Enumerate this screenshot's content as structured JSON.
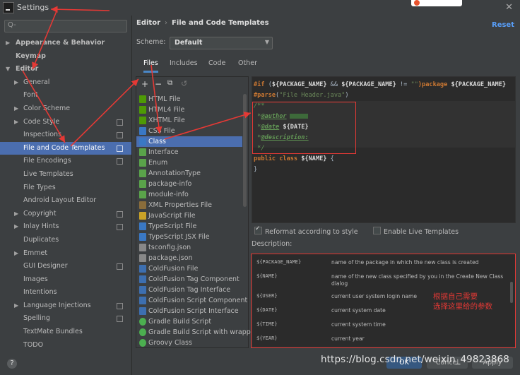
{
  "window": {
    "title": "Settings"
  },
  "search": {
    "placeholder": "Q-"
  },
  "sidebar": {
    "items": [
      {
        "label": "Appearance & Behavior"
      },
      {
        "label": "Keymap"
      },
      {
        "label": "Editor"
      },
      {
        "label": "General"
      },
      {
        "label": "Font"
      },
      {
        "label": "Color Scheme"
      },
      {
        "label": "Code Style"
      },
      {
        "label": "Inspections"
      },
      {
        "label": "File and Code Templates"
      },
      {
        "label": "File Encodings"
      },
      {
        "label": "Live Templates"
      },
      {
        "label": "File Types"
      },
      {
        "label": "Android Layout Editor"
      },
      {
        "label": "Copyright"
      },
      {
        "label": "Inlay Hints"
      },
      {
        "label": "Duplicates"
      },
      {
        "label": "Emmet"
      },
      {
        "label": "GUI Designer"
      },
      {
        "label": "Images"
      },
      {
        "label": "Intentions"
      },
      {
        "label": "Language Injections"
      },
      {
        "label": "Spelling"
      },
      {
        "label": "TextMate Bundles"
      },
      {
        "label": "TODO"
      }
    ]
  },
  "breadcrumb": {
    "root": "Editor",
    "separator": "›",
    "current": "File and Code Templates"
  },
  "reset_label": "Reset",
  "scheme": {
    "label": "Scheme:",
    "value": "Default"
  },
  "tabs": [
    {
      "label": "Files"
    },
    {
      "label": "Includes"
    },
    {
      "label": "Code"
    },
    {
      "label": "Other"
    }
  ],
  "templates": [
    {
      "label": "HTML File",
      "icon": "html-file-icon",
      "color": "#4e9a06"
    },
    {
      "label": "HTML4 File",
      "icon": "html-file-icon",
      "color": "#4e9a06"
    },
    {
      "label": "XHTML File",
      "icon": "html-file-icon",
      "color": "#4e9a06"
    },
    {
      "label": "CSS File",
      "icon": "css-file-icon",
      "color": "#3a78c4"
    },
    {
      "label": "Class",
      "icon": "class-icon",
      "color": "#3a78c4"
    },
    {
      "label": "Interface",
      "icon": "interface-icon",
      "color": "#5aa34a"
    },
    {
      "label": "Enum",
      "icon": "enum-icon",
      "color": "#5aa34a"
    },
    {
      "label": "AnnotationType",
      "icon": "annotation-icon",
      "color": "#5aa34a"
    },
    {
      "label": "package-info",
      "icon": "package-info-icon",
      "color": "#5aa34a"
    },
    {
      "label": "module-info",
      "icon": "module-info-icon",
      "color": "#5aa34a"
    },
    {
      "label": "XML Properties File",
      "icon": "xml-file-icon",
      "color": "#8a6d3b"
    },
    {
      "label": "JavaScript File",
      "icon": "js-file-icon",
      "color": "#c9a227"
    },
    {
      "label": "TypeScript File",
      "icon": "ts-file-icon",
      "color": "#3a78c4"
    },
    {
      "label": "TypeScript JSX File",
      "icon": "tsx-file-icon",
      "color": "#3a78c4"
    },
    {
      "label": "tsconfig.json",
      "icon": "json-file-icon",
      "color": "#888888"
    },
    {
      "label": "package.json",
      "icon": "json-file-icon",
      "color": "#888888"
    },
    {
      "label": "ColdFusion File",
      "icon": "coldfusion-icon",
      "color": "#3d6fb0"
    },
    {
      "label": "ColdFusion Tag Component",
      "icon": "coldfusion-icon",
      "color": "#3d6fb0"
    },
    {
      "label": "ColdFusion Tag Interface",
      "icon": "coldfusion-icon",
      "color": "#3d6fb0"
    },
    {
      "label": "ColdFusion Script Component",
      "icon": "coldfusion-icon",
      "color": "#3d6fb0"
    },
    {
      "label": "ColdFusion Script Interface",
      "icon": "coldfusion-icon",
      "color": "#3d6fb0"
    },
    {
      "label": "Gradle Build Script",
      "icon": "gradle-icon",
      "color": "#4caf50"
    },
    {
      "label": "Gradle Build Script with wrappe",
      "icon": "gradle-icon",
      "color": "#4caf50"
    },
    {
      "label": "Groovy Class",
      "icon": "groovy-icon",
      "color": "#4caf50"
    }
  ],
  "editor": {
    "l1a": "#if",
    "l1b": " (",
    "l1c": "${PACKAGE_NAME}",
    "l1d": " && ",
    "l1e": "${PACKAGE_NAME}",
    "l1f": " != ",
    "l1g": "\"\"",
    "l1h": ")package ",
    "l1i": "${PACKAGE_NAME}",
    "l2a": "#parse",
    "l2b": "(",
    "l2c": "\"File Header.java\"",
    "l2d": ")",
    "l3": "/**",
    "l4a": " *",
    "l4b": "@author",
    "l5a": " *",
    "l5b": "@date",
    "l5c": " ${DATE}",
    "l6a": " *",
    "l6b": "@description:",
    "l7": " */",
    "l8a": "public class ",
    "l8b": "${NAME}",
    "l8c": " {",
    "l9": "}"
  },
  "options": {
    "reformat": "Reformat according to style",
    "live_templates": "Enable Live Templates"
  },
  "description": {
    "label": "Description:",
    "rows": [
      {
        "name": "${PACKAGE_NAME}",
        "text": "name of the package in which the new class is created"
      },
      {
        "name": "${NAME}",
        "text": "name of the new class specified by you in the Create New Class dialog"
      },
      {
        "name": "${USER}",
        "text": "current user system login name"
      },
      {
        "name": "${DATE}",
        "text": "current system date"
      },
      {
        "name": "${TIME}",
        "text": "current system time"
      },
      {
        "name": "${YEAR}",
        "text": "current year"
      }
    ]
  },
  "annotation": {
    "line1": "根据自己需要",
    "line2": "选择这里给的参数"
  },
  "footer": {
    "ok": "OK",
    "cancel": "Cancel",
    "apply": "Apply"
  },
  "watermark": "https://blog.csdn.net/weixin_49823868",
  "colors": {
    "selection": "#4b6eaf",
    "annotation_red": "#e53935",
    "link": "#589df6"
  }
}
